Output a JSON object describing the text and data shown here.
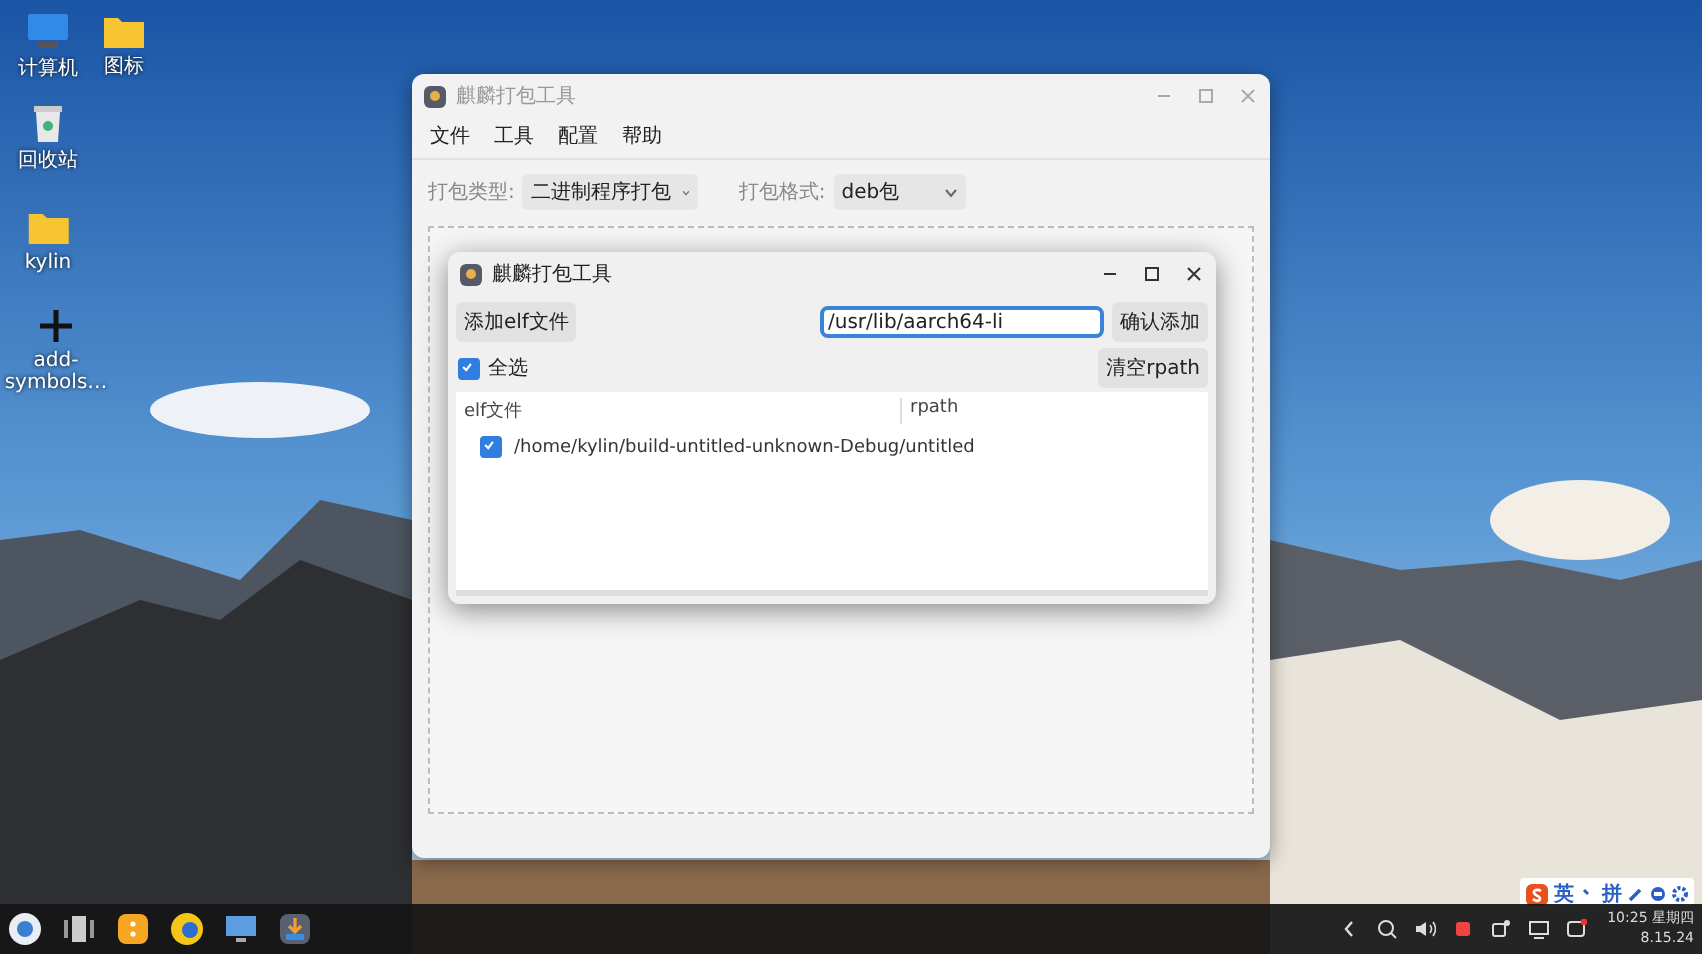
{
  "desktop_icons": [
    {
      "label": "计算机",
      "kind": "computer"
    },
    {
      "label": "图标",
      "kind": "folder"
    },
    {
      "label": "回收站",
      "kind": "trash"
    },
    {
      "label": "kylin",
      "kind": "folder"
    },
    {
      "label": "add-symbols…",
      "kind": "plus"
    }
  ],
  "main_window": {
    "title": "麒麟打包工具",
    "menu": [
      "文件",
      "工具",
      "配置",
      "帮助"
    ],
    "package_type": {
      "label": "打包类型:",
      "value": "二进制程序打包"
    },
    "package_format": {
      "label": "打包格式:",
      "value": "deb包"
    }
  },
  "dialog": {
    "title": "麒麟打包工具",
    "add_button": "添加elf文件",
    "path_field": {
      "value": "/usr/lib/aarch64-li"
    },
    "confirm_button": "确认添加",
    "select_all": {
      "label": "全选",
      "checked": true
    },
    "clear_button": "清空rpath",
    "table": {
      "columns": [
        "elf文件",
        "rpath"
      ],
      "rows": [
        {
          "file": "/home/kylin/build-untitled-unknown-Debug/untitled",
          "checked": true
        }
      ]
    }
  },
  "ime_toolbar": [
    "英",
    "拼"
  ],
  "taskbar": {
    "time": "10:25 星期四",
    "date": "8.15.24"
  }
}
